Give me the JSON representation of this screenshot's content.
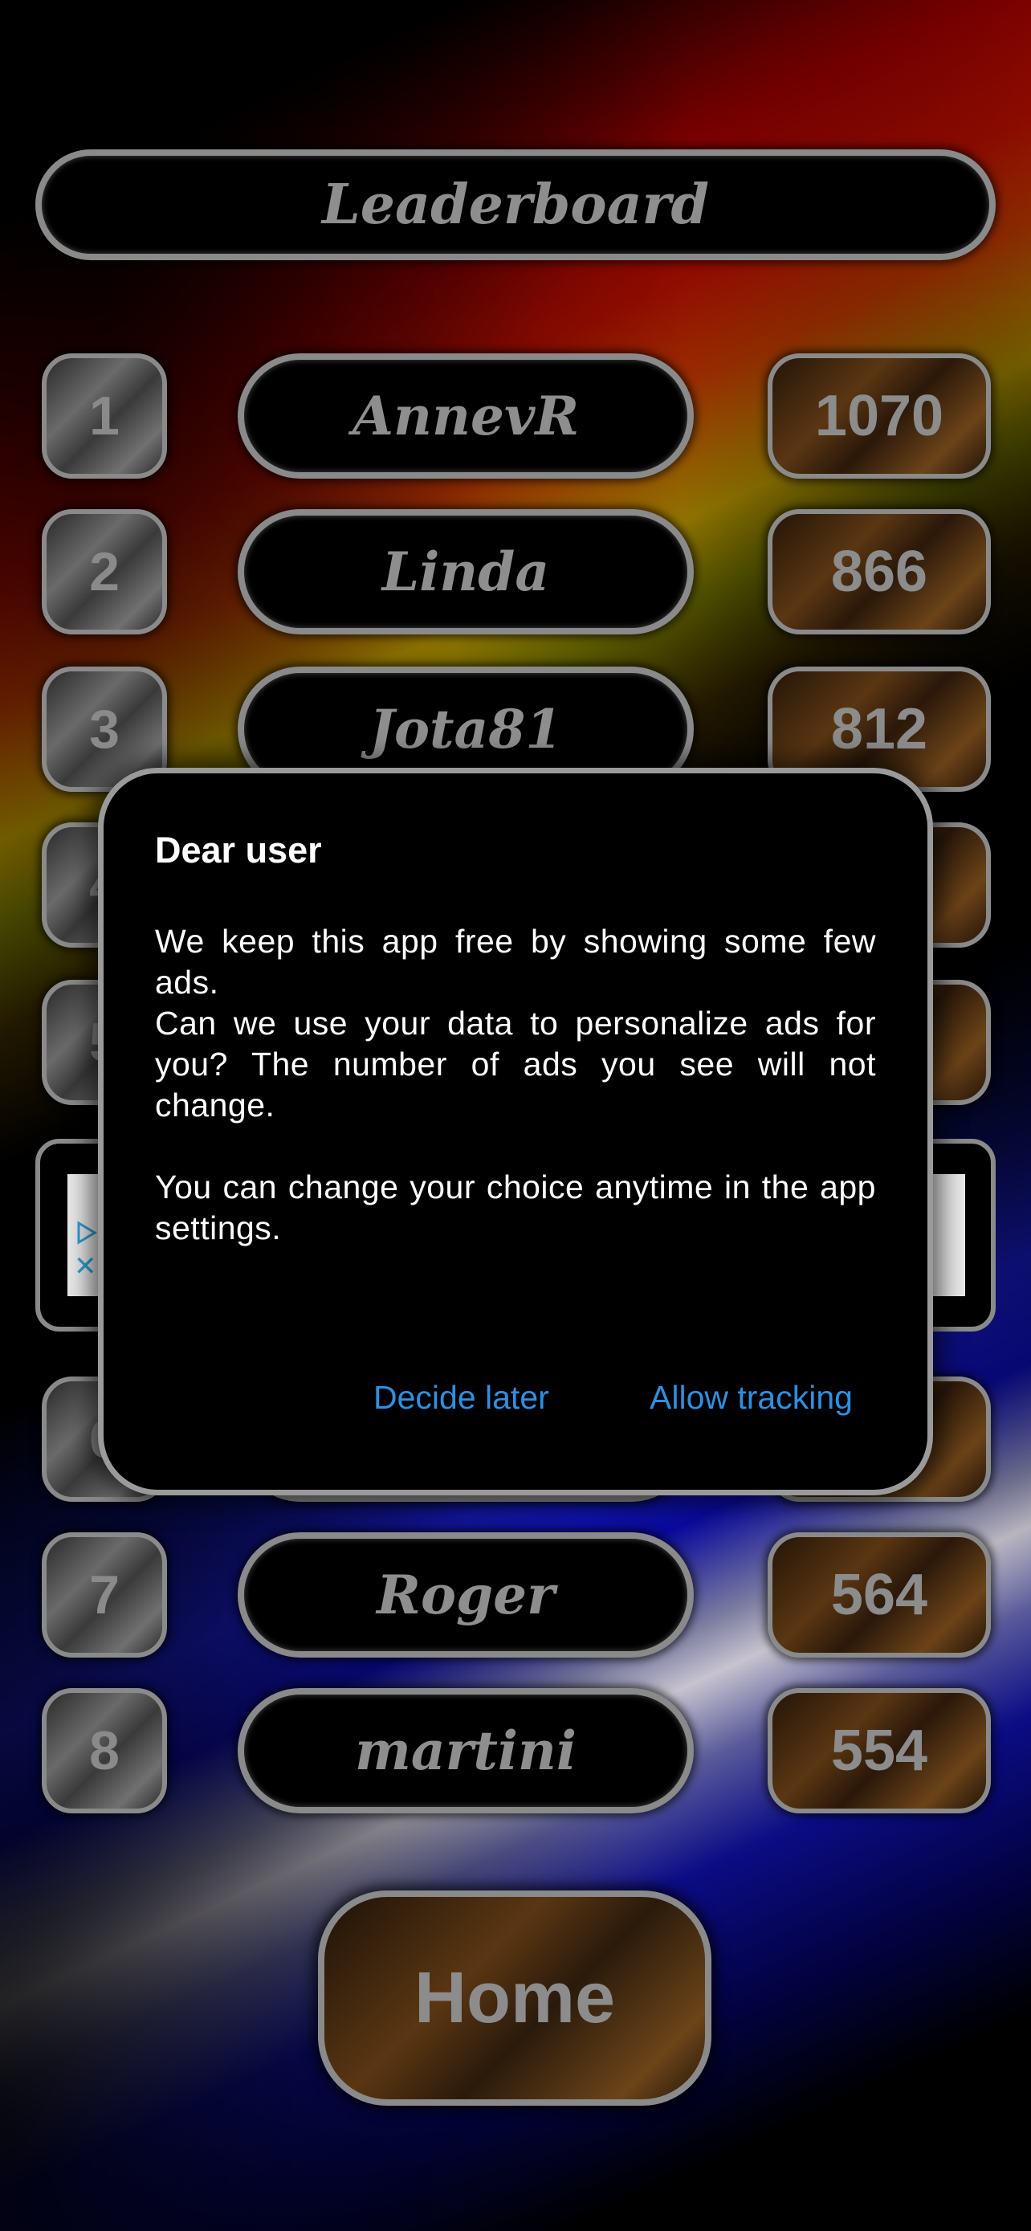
{
  "header": {
    "title": "Leaderboard"
  },
  "leaderboard": {
    "rows": [
      {
        "rank": "1",
        "name": "AnnevR",
        "score": "1070"
      },
      {
        "rank": "2",
        "name": "Linda",
        "score": "866"
      },
      {
        "rank": "3",
        "name": "Jota81",
        "score": "812"
      },
      {
        "rank": "4",
        "name": "",
        "score": ""
      },
      {
        "rank": "5",
        "name": "",
        "score": ""
      },
      {
        "rank": "6",
        "name": "",
        "score": ""
      },
      {
        "rank": "7",
        "name": "Roger",
        "score": "564"
      },
      {
        "rank": "8",
        "name": "martini",
        "score": "554"
      }
    ]
  },
  "ad": {
    "icon": "adchoices-icon",
    "close": "✕"
  },
  "nav": {
    "home_label": "Home"
  },
  "dialog": {
    "title": "Dear user",
    "paragraph1": "We keep this app free by showing some few ads.",
    "paragraph2": "Can we use your data to personalize ads for you? The number of ads you see will not change.",
    "paragraph3": "You can change your choice anytime in the app settings.",
    "decide_later_label": "Decide later",
    "allow_tracking_label": "Allow tracking"
  },
  "colors": {
    "accent": "#2f8fe0",
    "text_muted": "#8c8c8c"
  }
}
